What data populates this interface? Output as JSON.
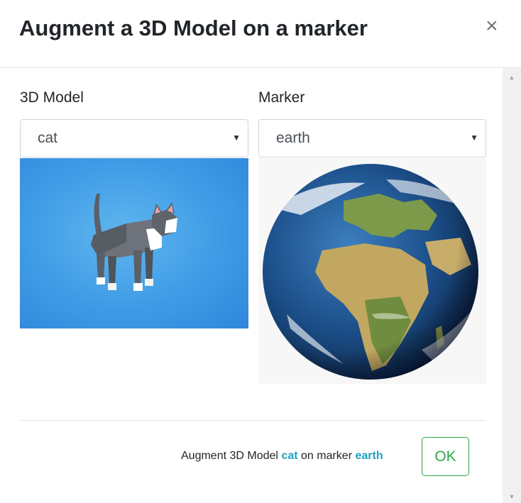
{
  "dialog": {
    "title": "Augment a 3D Model on a marker",
    "close_icon": "×"
  },
  "model": {
    "label": "3D Model",
    "selected": "cat"
  },
  "marker": {
    "label": "Marker",
    "selected": "earth"
  },
  "footer": {
    "prefix": "Augment 3D Model",
    "model_name": "cat",
    "middle": "on marker",
    "marker_name": "earth",
    "ok_label": "OK"
  },
  "colors": {
    "accent_text": "#1fa2c3",
    "ok_green": "#28a745",
    "cat_background": "#3f9be6"
  },
  "icons": {
    "close": "close-icon",
    "caret": "chevron-down-icon",
    "scroll_up": "scroll-up-icon",
    "scroll_down": "scroll-down-icon"
  }
}
